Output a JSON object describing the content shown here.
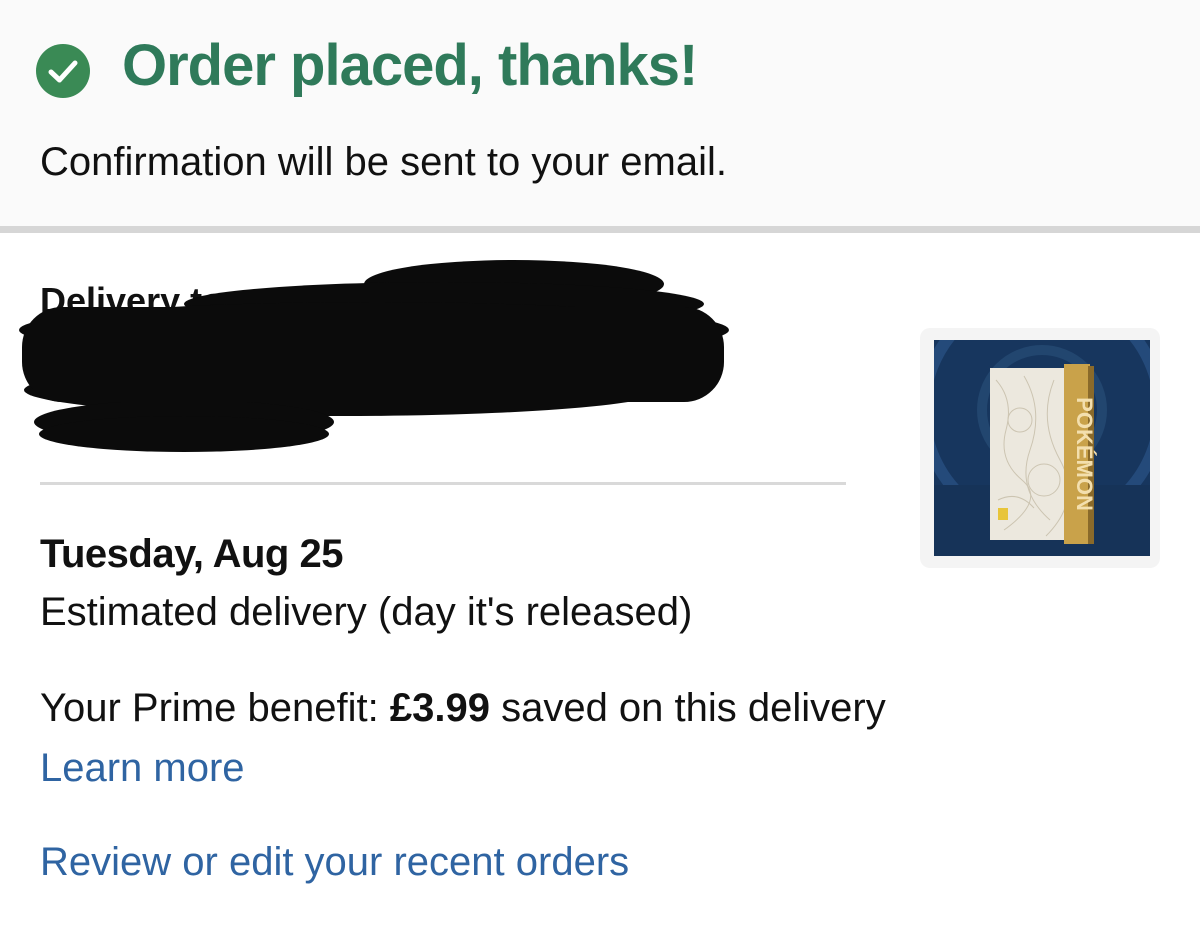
{
  "confirmation": {
    "title": "Order placed, thanks!",
    "subtitle": "Confirmation will be sent to your email.",
    "check_icon": "check-circle-icon",
    "accent_color": "#2f7a5a"
  },
  "delivery": {
    "address_label": "Delivery to",
    "date": "Tuesday, Aug 25",
    "estimate_text": "Estimated delivery (day it's released)"
  },
  "product": {
    "spine_text": "POKÉMON"
  },
  "prime": {
    "prefix": "Your Prime benefit:",
    "amount": "£3.99",
    "suffix": "saved on this delivery",
    "learn_more_label": "Learn more"
  },
  "links": {
    "review_orders_label": "Review or edit your recent orders",
    "link_color": "#2f64a2"
  }
}
